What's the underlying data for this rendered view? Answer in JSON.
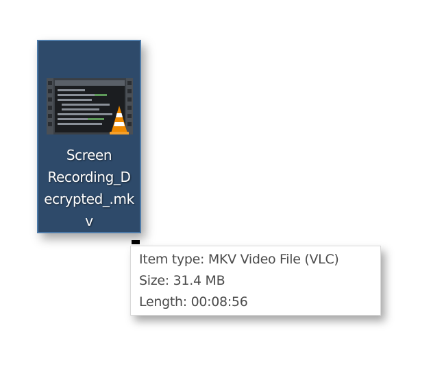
{
  "file": {
    "icon": "vlc-mkv-video-thumbnail-icon",
    "name_lines": [
      "Screen",
      "Recording_D",
      "ecrypted_.mk",
      "v"
    ],
    "selected": true
  },
  "tooltip": {
    "rows": [
      "Item type: MKV Video File (VLC)",
      "Size: 31.4 MB",
      "Length: 00:08:56"
    ]
  },
  "colors": {
    "selection_fill": "#2e4a6a",
    "selection_border": "#4d7aa8",
    "vlc_orange": "#f08a00",
    "tooltip_text": "#4b4b4b"
  }
}
